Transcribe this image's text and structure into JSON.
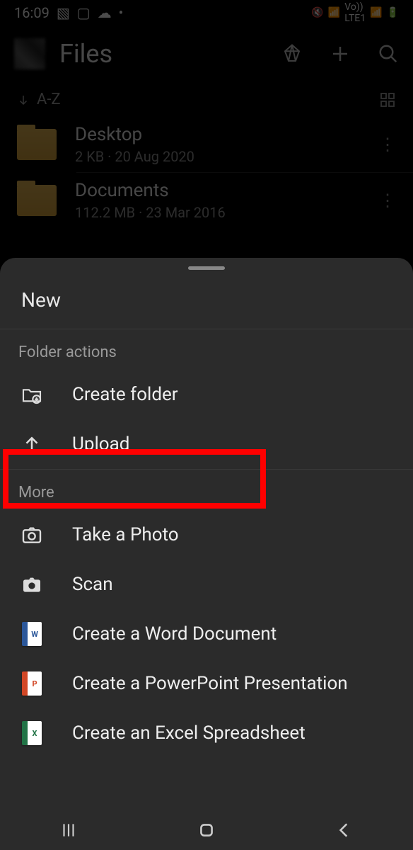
{
  "statusbar": {
    "time": "16:09"
  },
  "header": {
    "title": "Files"
  },
  "sort": {
    "label": "A-Z"
  },
  "files": [
    {
      "name": "Desktop",
      "meta": "2 KB · 20 Aug 2020"
    },
    {
      "name": "Documents",
      "meta": "112.2 MB · 23 Mar 2016"
    }
  ],
  "sheet": {
    "title": "New",
    "section1": "Folder actions",
    "createFolder": "Create folder",
    "upload": "Upload",
    "section2": "More",
    "takePhoto": "Take a Photo",
    "scan": "Scan",
    "word": "Create a Word Document",
    "ppt": "Create a PowerPoint Presentation",
    "xls": "Create an Excel Spreadsheet"
  }
}
